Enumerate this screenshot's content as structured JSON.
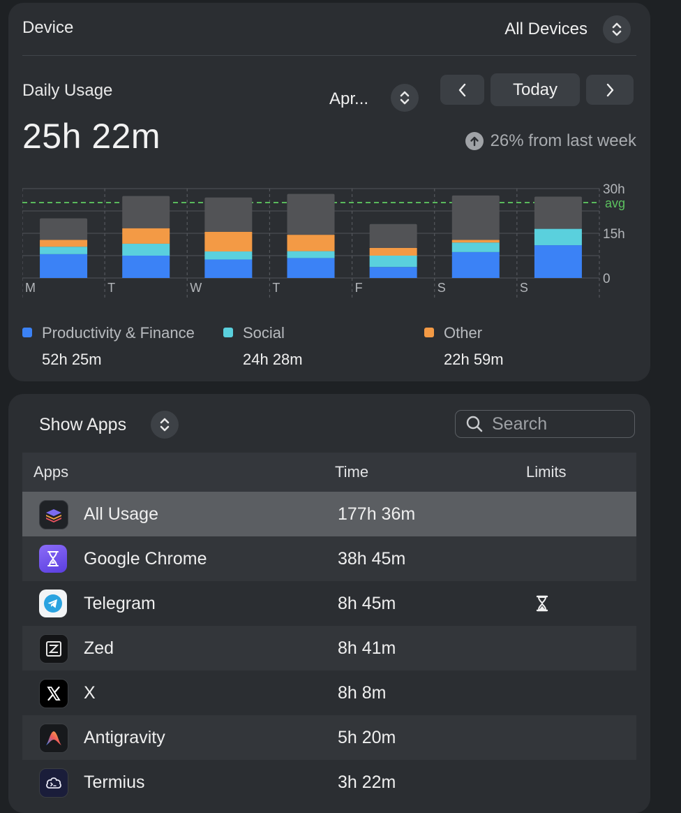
{
  "device": {
    "label": "Device",
    "selected": "All Devices"
  },
  "usage": {
    "title": "Daily Usage",
    "total": "25h 22m",
    "date_label": "Apr...",
    "today_label": "Today",
    "compare_text": "26% from last week"
  },
  "chart_data": {
    "type": "bar",
    "stacked": true,
    "categories": [
      "M",
      "T",
      "W",
      "T",
      "F",
      "S",
      "S"
    ],
    "series": [
      {
        "name": "Productivity & Finance",
        "color": "#3b82f6",
        "values": [
          8.0,
          7.5,
          6.2,
          6.7,
          3.7,
          8.7,
          11.0
        ]
      },
      {
        "name": "Social",
        "color": "#5ad0dd",
        "values": [
          2.5,
          4.0,
          2.7,
          2.3,
          3.8,
          3.2,
          5.5
        ]
      },
      {
        "name": "Other",
        "color": "#f39a45",
        "values": [
          2.3,
          5.2,
          6.6,
          5.5,
          2.6,
          0.9,
          0.0
        ]
      },
      {
        "name": "",
        "color": "#525356",
        "values": [
          7.2,
          10.8,
          11.5,
          13.7,
          8.0,
          14.9,
          10.8
        ]
      }
    ],
    "y_ticks": [
      "0",
      "15h",
      "30h"
    ],
    "ylim": [
      0,
      30
    ],
    "average": 25.3,
    "average_label": "avg",
    "grid": true,
    "legend": [
      {
        "name": "Productivity & Finance",
        "value": "52h 25m",
        "color": "#3b82f6"
      },
      {
        "name": "Social",
        "value": "24h 28m",
        "color": "#5ad0dd"
      },
      {
        "name": "Other",
        "value": "22h 59m",
        "color": "#f39a45"
      }
    ]
  },
  "apps": {
    "filter_label": "Show Apps",
    "search_placeholder": "Search",
    "columns": [
      "Apps",
      "Time",
      "Limits"
    ],
    "rows": [
      {
        "name": "All Usage",
        "time": "177h 36m",
        "icon": "stack-layers-icon",
        "limit": ""
      },
      {
        "name": "Google Chrome",
        "time": "38h 45m",
        "icon": "hourglass-app-icon",
        "limit": ""
      },
      {
        "name": "Telegram",
        "time": "8h 45m",
        "icon": "telegram-icon",
        "limit": "hourglass-icon"
      },
      {
        "name": "Zed",
        "time": "8h 41m",
        "icon": "zed-icon",
        "limit": ""
      },
      {
        "name": "X",
        "time": "8h 8m",
        "icon": "x-logo-icon",
        "limit": ""
      },
      {
        "name": "Antigravity",
        "time": "5h 20m",
        "icon": "antigravity-icon",
        "limit": ""
      },
      {
        "name": "Termius",
        "time": "3h 22m",
        "icon": "termius-icon",
        "limit": ""
      }
    ]
  }
}
